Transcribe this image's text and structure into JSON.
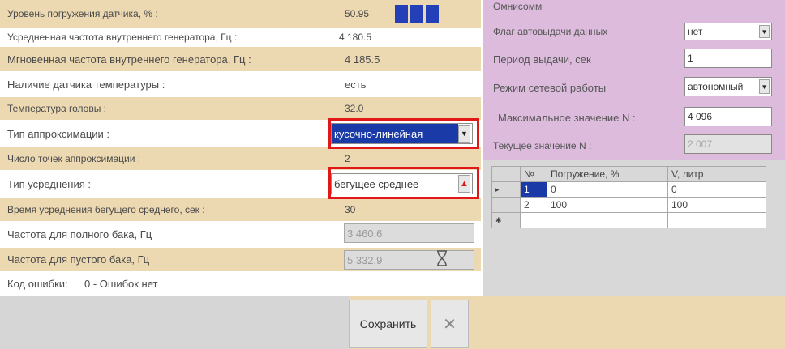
{
  "params": [
    {
      "label": "Уровень погружения датчика, % :",
      "value": "50.95"
    },
    {
      "label": "Усредненная частота внутреннего генератора, Гц :",
      "value": "4 180.5"
    },
    {
      "label": "Мгновенная частота внутреннего генератора, Гц :",
      "value": "4 185.5"
    },
    {
      "label": "Наличие датчика температуры :",
      "value": "есть"
    },
    {
      "label": "Температура головы :",
      "value": "32.0"
    },
    {
      "label": "Тип аппроксимации :",
      "value": "кусочно-линейная"
    },
    {
      "label": "Число точек аппроксимации :",
      "value": "2"
    },
    {
      "label": "Тип усреднения :",
      "value": "бегущее среднее"
    },
    {
      "label": "Время усреднения бегущего среднего, сек :",
      "value": "30"
    },
    {
      "label": "Частота для полного бака, Гц",
      "value": "3 460.6"
    },
    {
      "label": "Частота для пустого бака, Гц",
      "value": "5 332.9"
    }
  ],
  "level_bars": {
    "filled": 3,
    "total": 4,
    "color": "#2440b8"
  },
  "error": {
    "label": "Код ошибки:",
    "value": "0 - Ошибок нет"
  },
  "buttons": {
    "save": "Сохранить",
    "cancel": "✕"
  },
  "settings": {
    "title": "Омнисомм",
    "auto_flag_label": "Флаг автовыдачи данных",
    "auto_flag_value": "нет",
    "period_label": "Период выдачи, сек",
    "period_value": "1",
    "network_label": "Режим сетевой работы",
    "network_value": "автономный",
    "max_n_label": "Максимальное значение N :",
    "max_n_value": "4 096",
    "cur_n_label": "Текущее значение N :",
    "cur_n_value": "2 007"
  },
  "table": {
    "columns": [
      "№",
      "Погружение, %",
      "V, литр"
    ],
    "rows": [
      {
        "marker": "▸",
        "n": "1",
        "depth": "0",
        "volume": "0"
      },
      {
        "marker": "",
        "n": "2",
        "depth": "100",
        "volume": "100"
      },
      {
        "marker": "✱",
        "n": "",
        "depth": "",
        "volume": ""
      }
    ]
  },
  "colors": {
    "tan": "#ecd9b2",
    "lilac": "#dcbbdc",
    "highlight": "#e01818",
    "selection": "#1a3aa8"
  }
}
